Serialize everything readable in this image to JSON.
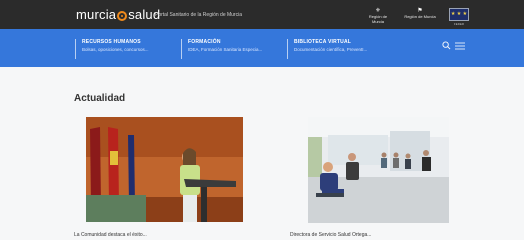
{
  "header": {
    "logo_left": "murcia",
    "logo_right": "salud",
    "tagline": "Portal Sanitario de la Región de Murcia",
    "partners": [
      {
        "label": "Región de Murcia"
      },
      {
        "label": "Región de Murcia"
      }
    ],
    "eu_caption": "FEDER"
  },
  "nav": {
    "items": [
      {
        "title": "RECURSOS HUMANOS",
        "subtitle": "Bolsas, oposiciones, concursos..."
      },
      {
        "title": "FORMACIÓN",
        "subtitle": "IDEA, Formación Sanitaria Especia..."
      },
      {
        "title": "BIBLIOTECA VIRTUAL",
        "subtitle": "Documentación científica, PreventI..."
      }
    ]
  },
  "main": {
    "section_title": "Actualidad",
    "news": [
      {
        "title": "La Comunidad destaca el éxito..."
      },
      {
        "title": "Directora de Servicio Salud Ortega..."
      }
    ]
  },
  "colors": {
    "topbar": "#2b2b2b",
    "navbar": "#3577db",
    "logo_accent": "#f08a1c",
    "page_bg": "#f6f7f8"
  }
}
